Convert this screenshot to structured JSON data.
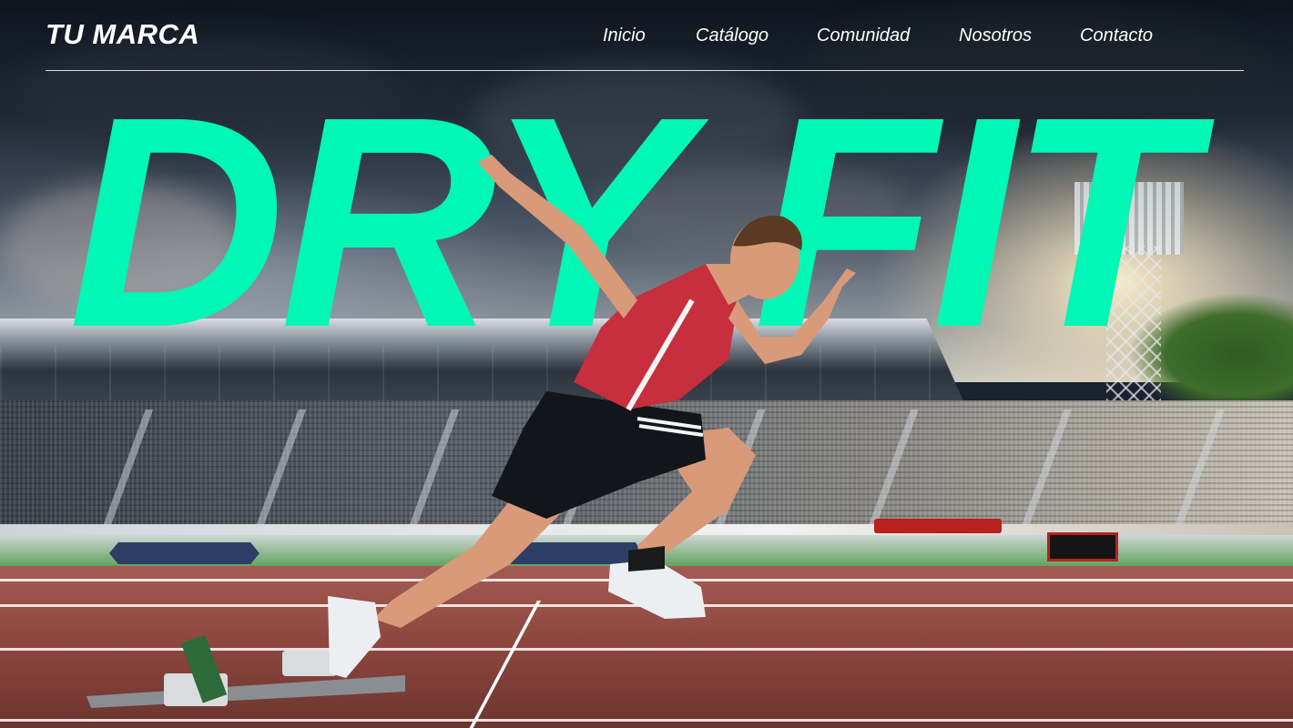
{
  "header": {
    "brand": "TU MARCA",
    "nav": [
      "Inicio",
      "Catálogo",
      "Comunidad",
      "Nosotros",
      "Contacto"
    ]
  },
  "hero": {
    "headline": "DRY FIT",
    "accent_color": "#00f7b5"
  }
}
